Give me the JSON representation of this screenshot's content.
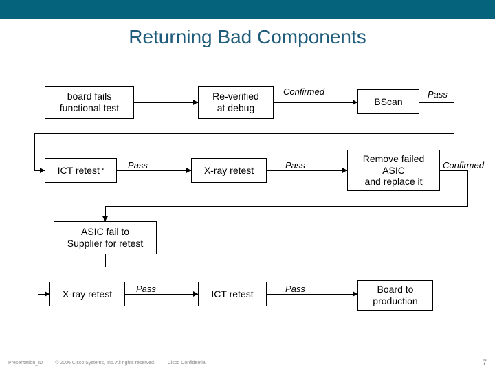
{
  "brandbar_color": "#05637c",
  "title": "Returning Bad Components",
  "boxes": {
    "board_fails": "board fails\nfunctional test",
    "reverified": "Re-verified\nat debug",
    "bscan": "BScan",
    "ict_retest1": "ICT retest",
    "ict_marker": "*",
    "xray_retest1": "X-ray retest",
    "remove": "Remove failed\nASIC\nand replace it",
    "asic_fail": "ASIC fail to\nSupplier for retest",
    "xray_retest2": "X-ray retest",
    "ict_retest2": "ICT retest",
    "board_prod": "Board to\nproduction"
  },
  "edges": {
    "confirmed": "Confirmed",
    "pass": "Pass"
  },
  "footer": {
    "pres_id": "Presentation_ID",
    "copyright": "© 2006 Cisco Systems, Inc. All rights reserved.",
    "conf": "Cisco Confidential",
    "page": "7"
  }
}
